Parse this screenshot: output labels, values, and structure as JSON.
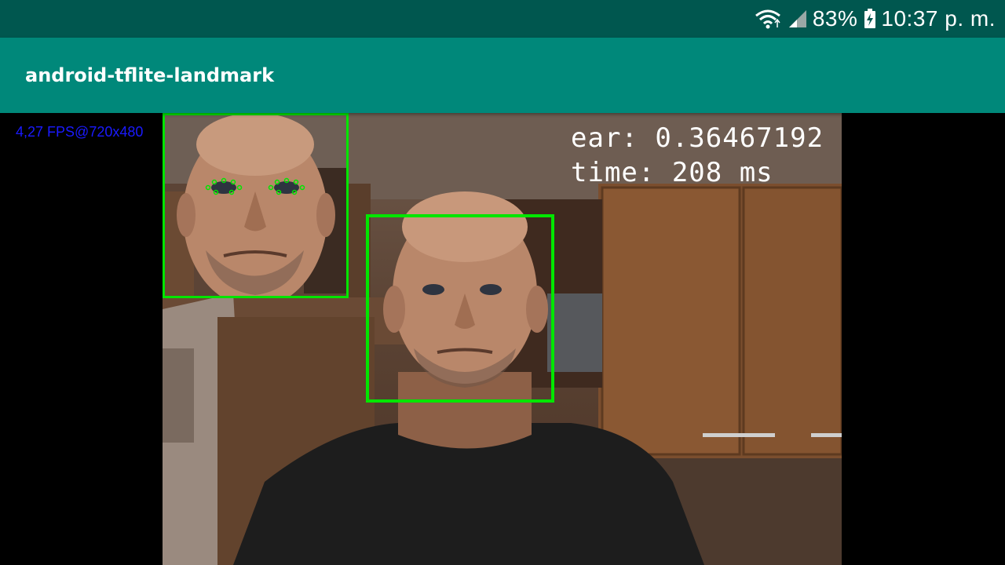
{
  "status_bar": {
    "battery_percent": "83%",
    "time": "10:37 p. m.",
    "icons": [
      "wifi-icon",
      "signal-icon",
      "battery-charging-icon"
    ]
  },
  "app_bar": {
    "title": "android-tflite-landmark"
  },
  "camera": {
    "fps_label": "4,27 FPS@720x480",
    "ear_label": "ear: 0.36467192",
    "time_label": "time: 208 ms"
  },
  "colors": {
    "status_bar": "#00574f",
    "app_bar": "#00887a",
    "detection_box": "#00e600",
    "fps_text": "#1a1aff"
  }
}
